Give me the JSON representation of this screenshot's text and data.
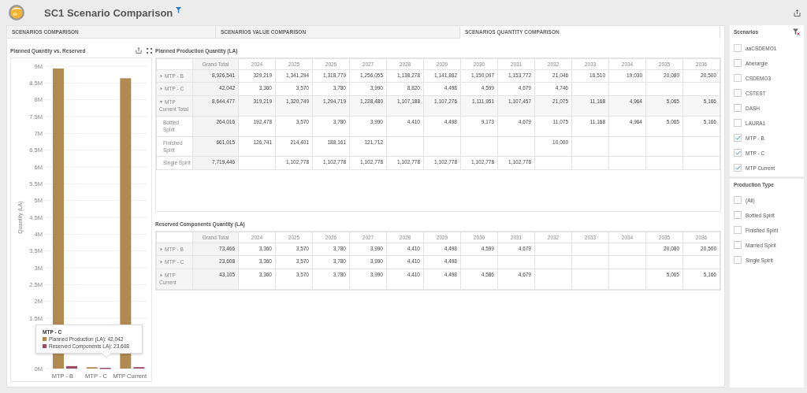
{
  "header": {
    "title": "SC1 Scenario Comparison"
  },
  "tabs": [
    {
      "label": "SCENARIOS COMPARISON",
      "selected": false
    },
    {
      "label": "SCENARIOS VALUE COMPARISON",
      "selected": false
    },
    {
      "label": "SCENARIOS QUANTITY COMPARISON",
      "selected": true
    }
  ],
  "chart_panel": {
    "title": "Planned Quantity vs. Reserved",
    "chart_data": {
      "type": "bar",
      "grid": true,
      "ylabel": "Quantity (LA)",
      "categories": [
        "MTP - B",
        "MTP - C",
        "MTP Current"
      ],
      "series": [
        {
          "name": "Planned Production (LA)",
          "color": "#b08a50",
          "values": [
            8930000,
            42042,
            8640000
          ]
        },
        {
          "name": "Reserved Components LA)",
          "color": "#9e4a63",
          "values": [
            73466,
            23608,
            43105
          ]
        }
      ],
      "ylim": [
        0,
        9000000
      ],
      "yticks": [
        {
          "value": 0,
          "label": "0M"
        },
        {
          "value": 1500000,
          "label": "1.5M"
        },
        {
          "value": 2000000,
          "label": "2M"
        },
        {
          "value": 2500000,
          "label": "2.5M"
        },
        {
          "value": 3000000,
          "label": "3M"
        },
        {
          "value": 3500000,
          "label": "3.5M"
        },
        {
          "value": 4000000,
          "label": "4M"
        },
        {
          "value": 4500000,
          "label": "4.5M"
        },
        {
          "value": 5000000,
          "label": "5M"
        },
        {
          "value": 5500000,
          "label": "5.5M"
        },
        {
          "value": 6000000,
          "label": "6M"
        },
        {
          "value": 6500000,
          "label": "6.5M"
        },
        {
          "value": 7000000,
          "label": "7M"
        },
        {
          "value": 7500000,
          "label": "7.5M"
        },
        {
          "value": 8000000,
          "label": "8M"
        },
        {
          "value": 8500000,
          "label": "8.5M"
        },
        {
          "value": 9000000,
          "label": "9M"
        }
      ]
    },
    "tooltip": {
      "title": "MTP - C",
      "values": [
        ": 42,042",
        ": 23,608"
      ]
    }
  },
  "planned_table": {
    "title": "Planned Production Quantity (LA)",
    "columns": [
      "Grand Total",
      "2024",
      "2025",
      "2026",
      "2027",
      "2028",
      "2029",
      "2030",
      "2031",
      "2032",
      "2033",
      "2034",
      "2035",
      "2036"
    ],
    "rows": [
      {
        "label": "MTP - B",
        "expanded": false,
        "cells": [
          "8,926,541",
          "329,219",
          "1,341,294",
          "1,318,779",
          "1,256,055",
          "1,138,278",
          "1,141,882",
          "1,150,097",
          "1,153,772",
          "21,046",
          "16,510",
          "19,030",
          "20,080",
          "20,500"
        ]
      },
      {
        "label": "MTP - C",
        "expanded": false,
        "cells": [
          "42,042",
          "3,360",
          "3,570",
          "3,780",
          "3,990",
          "8,820",
          "4,498",
          "4,599",
          "4,679",
          "4,746",
          null,
          null,
          null,
          null
        ]
      },
      {
        "label": "MTP Current Total",
        "expanded": true,
        "cells": [
          "8,644,477",
          "319,219",
          "1,320,749",
          "1,294,719",
          "1,228,480",
          "1,107,188",
          "1,107,276",
          "1,111,951",
          "1,107,457",
          "21,075",
          "11,168",
          "4,964",
          "5,065",
          "5,166"
        ],
        "children": [
          {
            "label": "Bottled Spirit",
            "cells": [
              "264,016",
              "192,478",
              "3,570",
              "3,780",
              "3,990",
              "4,410",
              "4,498",
              "9,173",
              "4,679",
              "11,075",
              "11,168",
              "4,964",
              "5,065",
              "5,166"
            ]
          },
          {
            "label": "Finished Spirit",
            "cells": [
              "661,015",
              "126,741",
              "214,401",
              "188,161",
              "121,712",
              null,
              null,
              null,
              null,
              "10,000",
              null,
              null,
              null,
              null
            ]
          },
          {
            "label": "Single Spirit",
            "cells": [
              "7,719,446",
              null,
              "1,102,778",
              "1,102,778",
              "1,102,778",
              "1,102,778",
              "1,102,778",
              "1,102,778",
              "1,102,778",
              null,
              null,
              null,
              null,
              null
            ]
          }
        ]
      }
    ]
  },
  "reserved_table": {
    "title": "Reserved Components Quantity (LA)",
    "columns": [
      "Grand Total",
      "2024",
      "2025",
      "2026",
      "2027",
      "2028",
      "2029",
      "2030",
      "2031",
      "2032",
      "2033",
      "2034",
      "2035",
      "2036"
    ],
    "rows": [
      {
        "label": "MTP - B",
        "expanded": false,
        "cells": [
          "73,466",
          "3,360",
          "3,570",
          "3,780",
          "3,990",
          "4,410",
          "4,498",
          "4,599",
          "4,679",
          null,
          null,
          null,
          "20,080",
          "20,500"
        ]
      },
      {
        "label": "MTP - C",
        "expanded": false,
        "cells": [
          "23,608",
          "3,360",
          "3,570",
          "3,780",
          "3,990",
          "4,410",
          "4,498",
          null,
          null,
          null,
          null,
          null,
          null,
          null
        ]
      },
      {
        "label": "MTP Current",
        "expanded": false,
        "cells": [
          "43,105",
          "3,360",
          "3,570",
          "3,780",
          "3,990",
          "4,410",
          "4,498",
          "4,586",
          "4,679",
          null,
          null,
          null,
          "5,065",
          "5,166"
        ]
      }
    ]
  },
  "filters": [
    {
      "title": "Scenarios",
      "items": [
        {
          "label": "aaCSDEMO1",
          "checked": false
        },
        {
          "label": "Aberargie",
          "checked": false
        },
        {
          "label": "CSDEMO3",
          "checked": false
        },
        {
          "label": "CSTEST",
          "checked": false
        },
        {
          "label": "DASH",
          "checked": false
        },
        {
          "label": "LAURA1",
          "checked": false
        },
        {
          "label": "MTP - B",
          "checked": true
        },
        {
          "label": "MTP - C",
          "checked": true
        },
        {
          "label": "MTP Current",
          "checked": true
        }
      ]
    },
    {
      "title": "Production Type",
      "items": [
        {
          "label": "(All)",
          "checked": false
        },
        {
          "label": "Bottled Spirit",
          "checked": false
        },
        {
          "label": "Finished Spirit",
          "checked": false
        },
        {
          "label": "Married Spirit",
          "checked": false
        },
        {
          "label": "Single Spirit",
          "checked": false
        }
      ]
    }
  ]
}
